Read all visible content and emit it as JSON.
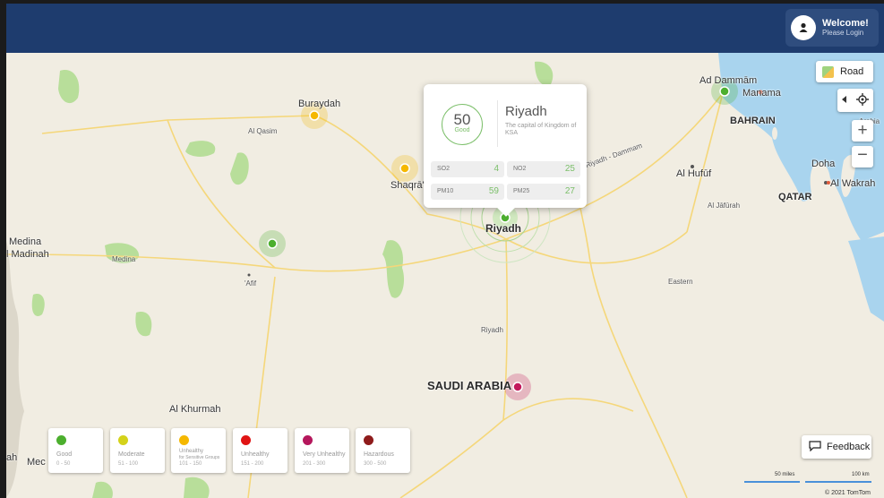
{
  "header": {
    "welcome": "Welcome!",
    "login": "Please Login"
  },
  "map_controls": {
    "style_label": "Road",
    "zoom_in": "+",
    "zoom_out": "−"
  },
  "places": [
    {
      "name": "Ad Dammām",
      "style": "normal"
    },
    {
      "name": "Manama",
      "style": "normal"
    },
    {
      "name": "BAHRAIN",
      "style": "bold"
    },
    {
      "name": "Buraydah",
      "style": "normal"
    },
    {
      "name": "Al Qasim",
      "style": "small"
    },
    {
      "name": "Shaqrā'",
      "style": "normal"
    },
    {
      "name": "Riyadh",
      "style": "bold"
    },
    {
      "name": "Riyadh - Dammam",
      "style": "small"
    },
    {
      "name": "Al Hufūf",
      "style": "normal"
    },
    {
      "name": "Doha",
      "style": "normal"
    },
    {
      "name": "Al Wakrah",
      "style": "normal"
    },
    {
      "name": "QATAR",
      "style": "bold"
    },
    {
      "name": "Al Jāfūrah",
      "style": "small"
    },
    {
      "name": "Medina",
      "style": "normal"
    },
    {
      "name": "l Madinah",
      "style": "normal"
    },
    {
      "name": "Medina",
      "style": "small"
    },
    {
      "name": "'Afif",
      "style": "small"
    },
    {
      "name": "Eastern",
      "style": "small"
    },
    {
      "name": "Riyadh",
      "style": "small"
    },
    {
      "name": "SAUDI ARABIA",
      "style": "country"
    },
    {
      "name": "Al Khurmah",
      "style": "normal"
    },
    {
      "name": "Mec",
      "style": "normal"
    },
    {
      "name": "ah",
      "style": "normal"
    },
    {
      "name": "Arabia",
      "style": "small"
    }
  ],
  "popup": {
    "aqi": "50",
    "status": "Good",
    "city": "Riyadh",
    "description": "The capital of Kingdom of KSA",
    "pollutants": [
      {
        "name": "SO2",
        "value": "4"
      },
      {
        "name": "NO2",
        "value": "25"
      },
      {
        "name": "PM10",
        "value": "59"
      },
      {
        "name": "PM25",
        "value": "27"
      }
    ]
  },
  "stations": [
    {
      "city": "Riyadh",
      "color": "#4caf2e"
    },
    {
      "city": "Buraydah",
      "color": "#f5b800"
    },
    {
      "city": "Shaqrā'",
      "color": "#f5b800"
    },
    {
      "city": "Ad Dammām",
      "color": "#4caf2e"
    },
    {
      "city": "'Afif",
      "color": "#4caf2e"
    },
    {
      "city": "SAUDI ARABIA",
      "color": "#c2185b"
    }
  ],
  "legend": [
    {
      "name": "Good",
      "range": "0 - 50",
      "color": "#4caf2e"
    },
    {
      "name": "Moderate",
      "range": "51 - 100",
      "color": "#d4d21a"
    },
    {
      "name": "Unhealthy",
      "sub": "for Sensitive Groups",
      "range": "101 - 150",
      "color": "#f5b800"
    },
    {
      "name": "Unhealthy",
      "range": "151 - 200",
      "color": "#e01414"
    },
    {
      "name": "Very Unhealthy",
      "range": "201 - 300",
      "color": "#b5175c"
    },
    {
      "name": "Hazardous",
      "range": "300 - 500",
      "color": "#8e1b1b"
    }
  ],
  "feedback_label": "Feedback",
  "scale": {
    "miles": "50 miles",
    "km": "100 km"
  },
  "copyright": "© 2021 TomTom",
  "colors": {
    "header": "#1e3c6e",
    "water": "#a9d4ee",
    "land": "#f1ede2",
    "green": "#b8de9a",
    "road": "#f5d77a"
  }
}
